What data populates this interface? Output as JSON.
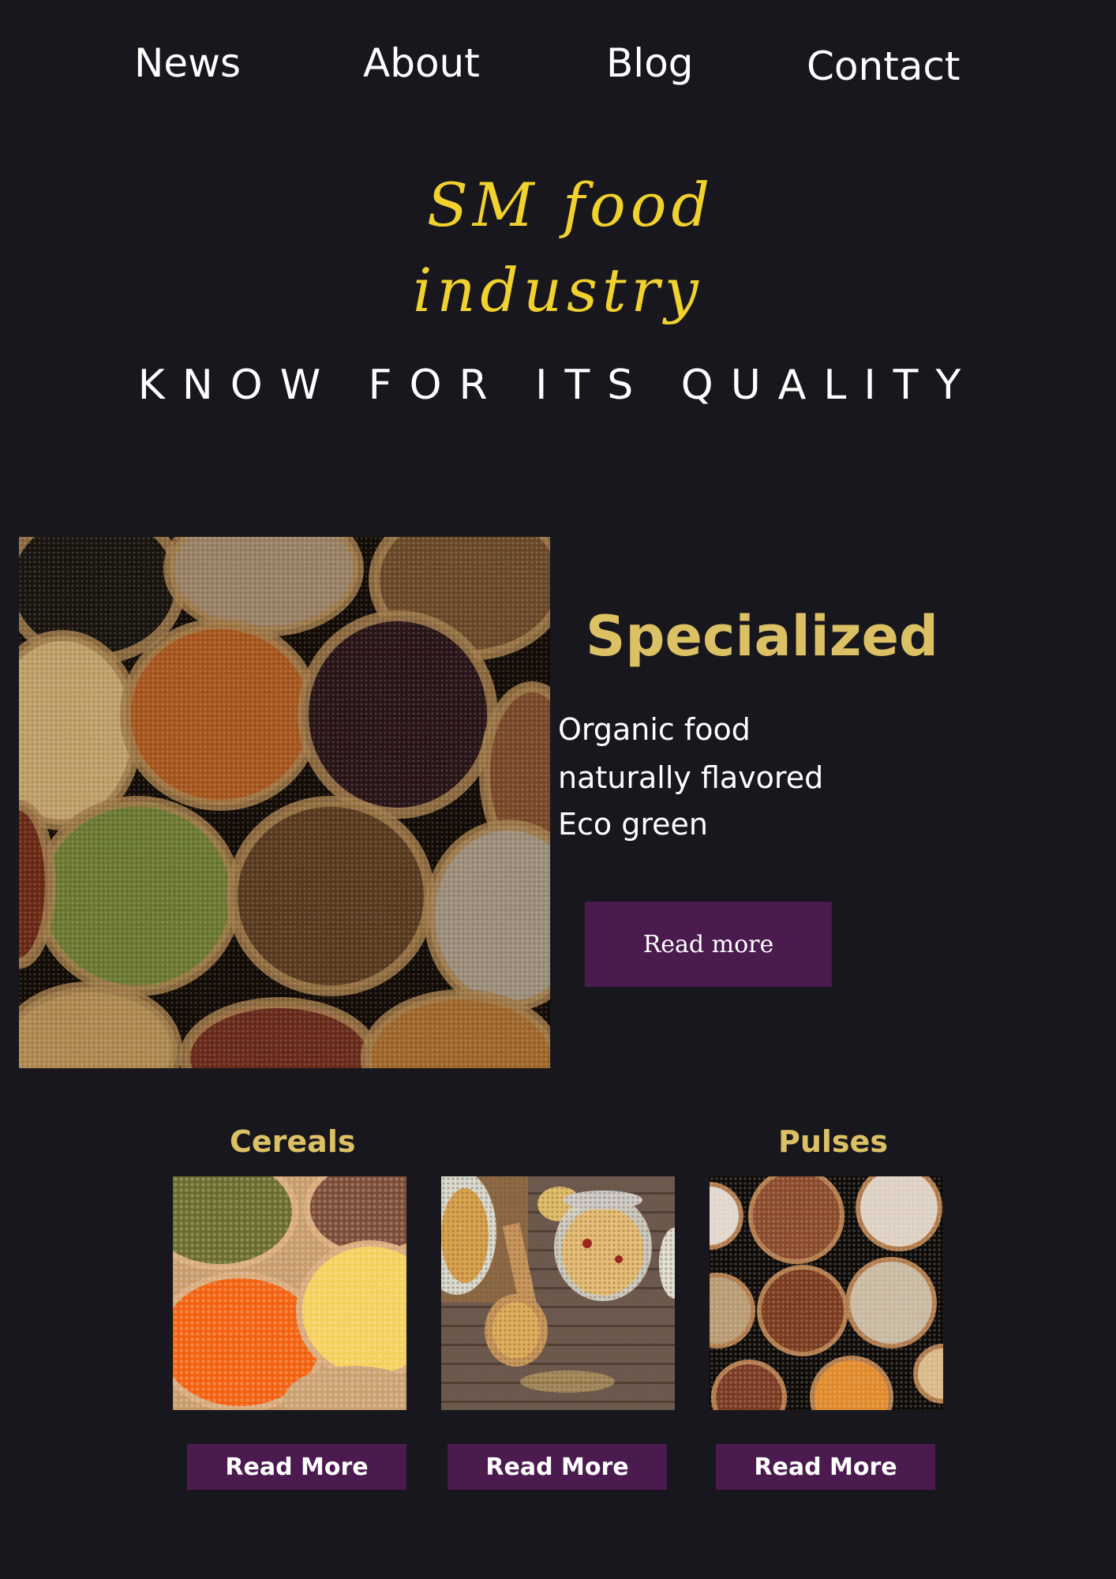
{
  "nav": {
    "items": [
      {
        "label": "News"
      },
      {
        "label": "About"
      },
      {
        "label": "Blog"
      },
      {
        "label": "Contact"
      }
    ]
  },
  "brand": {
    "line1": "SM food",
    "line2": "industry",
    "tagline": "KNOW FOR ITS QUALITY",
    "color": "#f1d12e"
  },
  "hero": {
    "title": "Specialized",
    "features": [
      "Organic food",
      "naturally flavored",
      "Eco green"
    ],
    "button_label": "Read more",
    "accent": "#dcc064",
    "button_color": "#4b1a4f"
  },
  "categories": {
    "titles": [
      "Cereals",
      "Pulses"
    ],
    "cards": [
      {
        "button_label": "Read More"
      },
      {
        "button_label": "Read More"
      },
      {
        "button_label": "Read More"
      }
    ]
  }
}
